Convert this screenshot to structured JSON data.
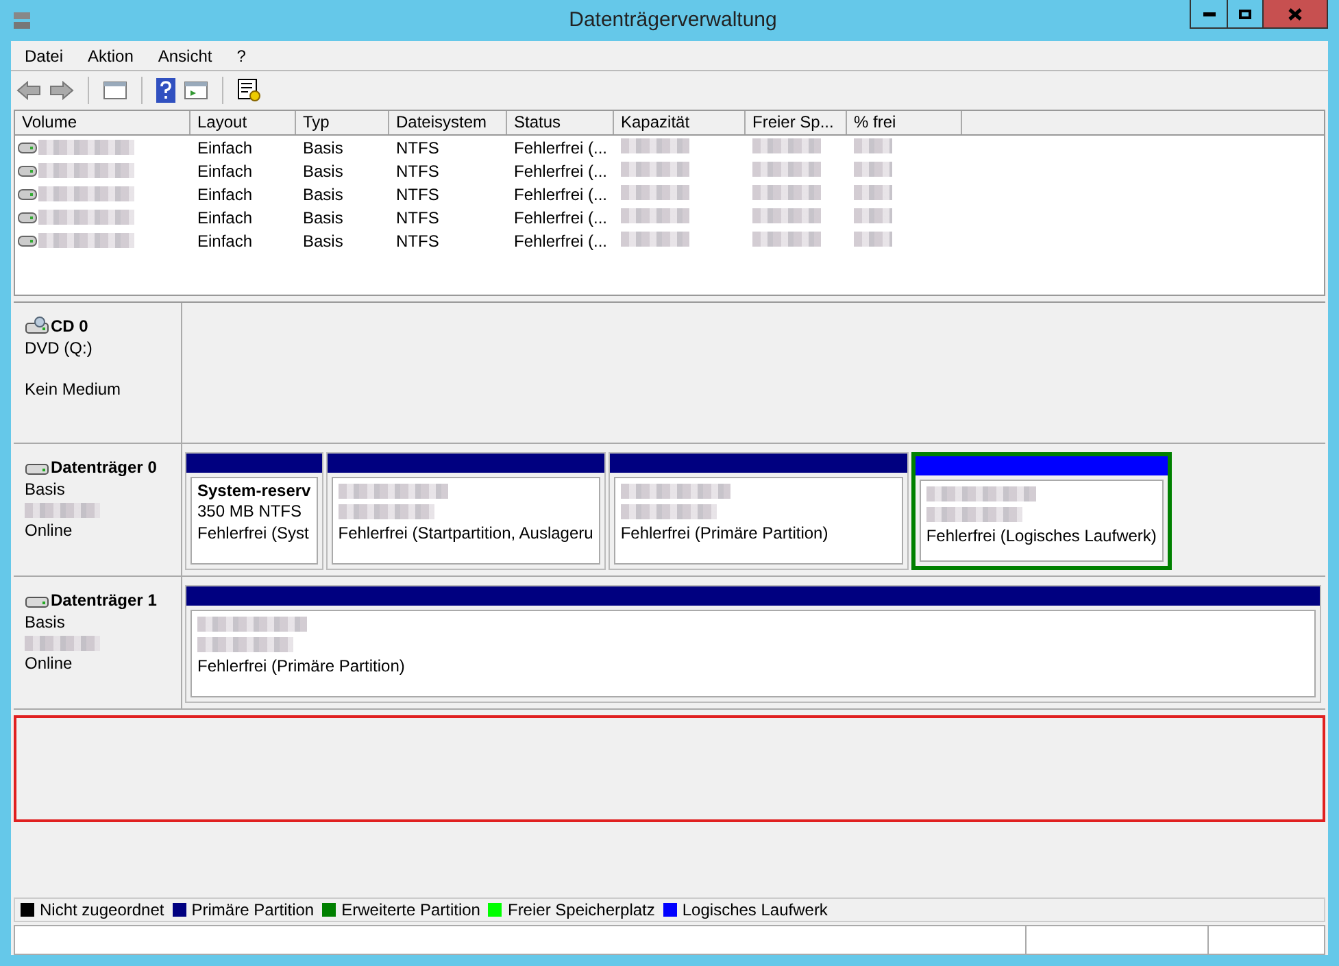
{
  "window": {
    "title": "Datenträgerverwaltung"
  },
  "menu": [
    {
      "label": "Datei"
    },
    {
      "label": "Aktion"
    },
    {
      "label": "Ansicht"
    },
    {
      "label": "?"
    }
  ],
  "table": {
    "columns": [
      "Volume",
      "Layout",
      "Typ",
      "Dateisystem",
      "Status",
      "Kapazität",
      "Freier Sp...",
      "% frei"
    ],
    "rows": [
      {
        "layout": "Einfach",
        "type": "Basis",
        "filesystem": "NTFS",
        "status": "Fehlerfrei (..."
      },
      {
        "layout": "Einfach",
        "type": "Basis",
        "filesystem": "NTFS",
        "status": "Fehlerfrei (..."
      },
      {
        "layout": "Einfach",
        "type": "Basis",
        "filesystem": "NTFS",
        "status": "Fehlerfrei (..."
      },
      {
        "layout": "Einfach",
        "type": "Basis",
        "filesystem": "NTFS",
        "status": "Fehlerfrei (..."
      },
      {
        "layout": "Einfach",
        "type": "Basis",
        "filesystem": "NTFS",
        "status": "Fehlerfrei (..."
      }
    ]
  },
  "disks": [
    {
      "kind": "cdrom",
      "name": "CD 0",
      "type": "DVD (Q:)",
      "state": "Kein Medium"
    },
    {
      "kind": "disk",
      "name": "Datenträger 0",
      "type": "Basis",
      "state": "Online",
      "partitions": [
        {
          "kind": "primary",
          "title": "System-reserv",
          "size": "350 MB NTFS",
          "status": "Fehlerfrei (Syst"
        },
        {
          "kind": "primary",
          "status": "Fehlerfrei (Startpartition, Auslageru"
        },
        {
          "kind": "primary",
          "status": "Fehlerfrei (Primäre Partition)"
        },
        {
          "kind": "logical",
          "status": "Fehlerfrei (Logisches Laufwerk)"
        }
      ]
    },
    {
      "kind": "disk",
      "name": "Datenträger 1",
      "type": "Basis",
      "state": "Online",
      "partitions": [
        {
          "kind": "primary",
          "status": "Fehlerfrei (Primäre Partition)"
        }
      ]
    }
  ],
  "legend": [
    {
      "label": "Nicht zugeordnet",
      "color": "#000000"
    },
    {
      "label": "Primäre Partition",
      "color": "#000080"
    },
    {
      "label": "Erweiterte Partition",
      "color": "#008000"
    },
    {
      "label": "Freier Speicherplatz",
      "color": "#00ff00"
    },
    {
      "label": "Logisches Laufwerk",
      "color": "#0000ff"
    }
  ]
}
